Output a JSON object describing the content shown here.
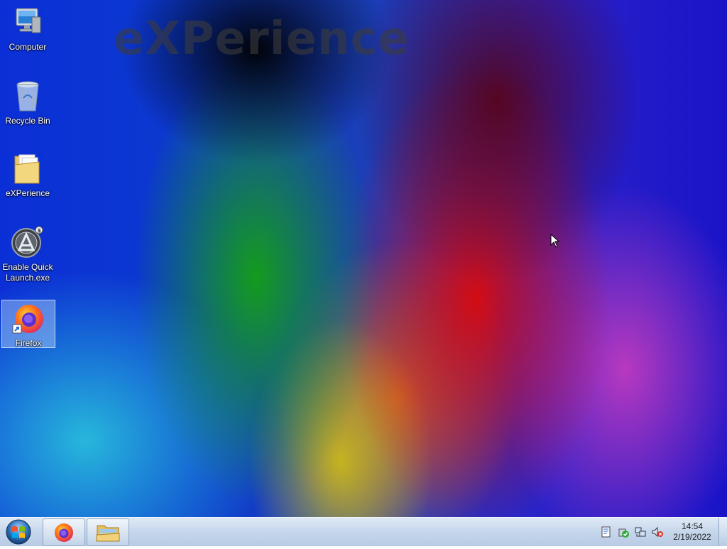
{
  "wallpaper": {
    "watermark_text": "eXPerience"
  },
  "desktop_icons": [
    {
      "label": "Computer",
      "icon": "computer-icon"
    },
    {
      "label": "Recycle Bin",
      "icon": "recycle-bin-icon"
    },
    {
      "label": "eXPerience",
      "icon": "folder-icon"
    },
    {
      "label": "Enable Quick Launch.exe",
      "icon": "quick-launch-app-icon"
    },
    {
      "label": "Firefox",
      "icon": "firefox-icon",
      "selected": true
    }
  ],
  "taskbar": {
    "start_icon": "windows-start-orb-icon",
    "pinned": [
      {
        "name": "Firefox",
        "icon": "firefox-icon"
      },
      {
        "name": "Windows Explorer",
        "icon": "explorer-folder-icon"
      }
    ],
    "tray_icons": [
      "action-center-icon",
      "security-shield-icon",
      "network-icon",
      "volume-muted-icon"
    ],
    "clock": {
      "time": "14:54",
      "date": "2/19/2022"
    }
  }
}
